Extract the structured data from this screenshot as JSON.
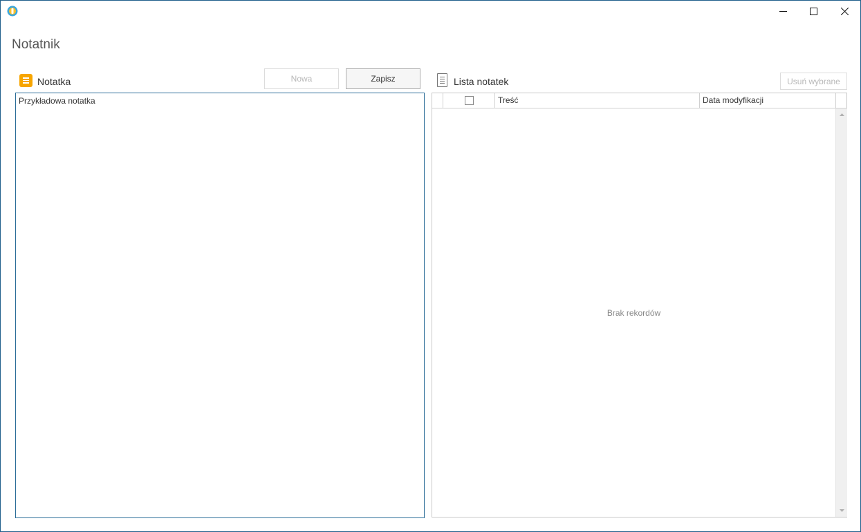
{
  "window": {
    "icon": "app-logo-icon",
    "controls": {
      "minimize": "minimize-icon",
      "maximize": "maximize-icon",
      "close": "close-icon"
    }
  },
  "page": {
    "title": "Notatnik"
  },
  "note_panel": {
    "label": "Notatka",
    "icon": "note-icon",
    "new_button": "Nowa",
    "save_button": "Zapisz",
    "editor_value": "Przykładowa notatka"
  },
  "list_panel": {
    "label": "Lista notatek",
    "icon": "document-list-icon",
    "delete_button": "Usuń wybrane",
    "columns": [
      "Treść",
      "Data modyfikacji"
    ],
    "rows": [],
    "empty_message": "Brak rekordów"
  },
  "colors": {
    "accent": "#f7a500",
    "border_focus": "#2a6c97",
    "window_border": "#1f5f8b"
  }
}
